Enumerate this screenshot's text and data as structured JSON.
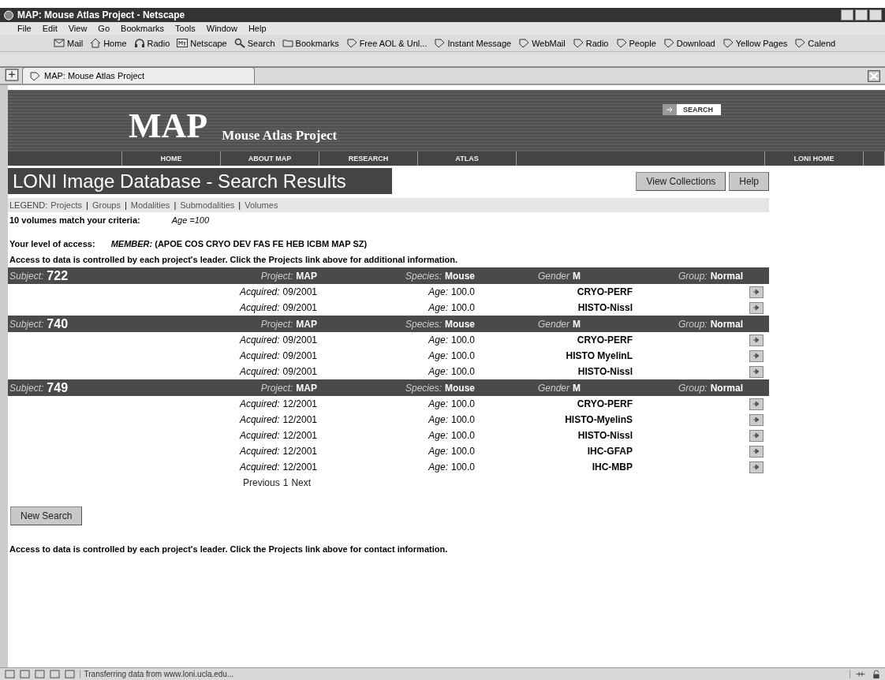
{
  "window": {
    "title": "MAP: Mouse Atlas Project - Netscape"
  },
  "menu": [
    "File",
    "Edit",
    "View",
    "Go",
    "Bookmarks",
    "Tools",
    "Window",
    "Help"
  ],
  "toolbar": [
    {
      "kind": "mail",
      "label": "Mail"
    },
    {
      "kind": "home",
      "label": "Home"
    },
    {
      "kind": "radio",
      "label": "Radio"
    },
    {
      "kind": "my",
      "label": "Netscape"
    },
    {
      "kind": "search",
      "label": "Search"
    },
    {
      "kind": "folder",
      "label": "Bookmarks"
    },
    {
      "kind": "bookmark",
      "label": "Free AOL & Unl..."
    },
    {
      "kind": "bookmark",
      "label": "Instant Message"
    },
    {
      "kind": "bookmark",
      "label": "WebMail"
    },
    {
      "kind": "bookmark",
      "label": "Radio"
    },
    {
      "kind": "bookmark",
      "label": "People"
    },
    {
      "kind": "bookmark",
      "label": "Download"
    },
    {
      "kind": "bookmark",
      "label": "Yellow Pages"
    },
    {
      "kind": "bookmark",
      "label": "Calend"
    }
  ],
  "tabs": [
    {
      "label": "MAP: Mouse Atlas Project",
      "selected": true
    }
  ],
  "site": {
    "logo": "MAP",
    "subtitle": "Mouse Atlas Project",
    "search": "SEARCH",
    "nav": [
      "HOME",
      "ABOUT MAP",
      "RESEARCH",
      "ATLAS",
      "LONI HOME"
    ]
  },
  "page_title": "LONI Image Database - Search Results",
  "buttons": [
    "View Collections",
    "Help"
  ],
  "legend": {
    "label": "LEGEND:",
    "items": [
      {
        "kind": "link",
        "text": "Projects"
      },
      {
        "kind": "separator",
        "text": "|"
      },
      {
        "kind": "link",
        "text": "Groups"
      },
      {
        "kind": "separator",
        "text": "|"
      },
      {
        "kind": "link",
        "text": "Modalities"
      },
      {
        "kind": "separator",
        "text": "|"
      },
      {
        "kind": "link",
        "text": "Submodalities"
      },
      {
        "kind": "separator",
        "text": "|"
      },
      {
        "kind": "link",
        "text": "Volumes"
      }
    ]
  },
  "match": {
    "count": "10 volumes match your criteria:",
    "criteria": "Age =100"
  },
  "access": {
    "label": "Your level of access:",
    "level": "MEMBER:",
    "projects": "(APOE COS CRYO DEV FAS FE HEB ICBM MAP SZ)"
  },
  "notice": "Access to data is controlled by each project's leader. Click the Projects link above for additional information.",
  "subjects": [
    {
      "subject_label": "Subject:",
      "id": "722",
      "project_label": "Project:",
      "project": "MAP",
      "species_label": "Species:",
      "species": "Mouse",
      "gender_label": "Gender",
      "gender": "M",
      "group_label": "Group:",
      "group": "Normal",
      "rows": [
        {
          "acquired_label": "Acquired:",
          "acquired": "09/2001",
          "age_label": "Age:",
          "age": "100.0",
          "volume": "CRYO-PERF"
        },
        {
          "acquired_label": "Acquired:",
          "acquired": "09/2001",
          "age_label": "Age:",
          "age": "100.0",
          "volume": "HISTO-Nissl"
        }
      ]
    },
    {
      "subject_label": "Subject:",
      "id": "740",
      "project_label": "Project:",
      "project": "MAP",
      "species_label": "Species:",
      "species": "Mouse",
      "gender_label": "Gender",
      "gender": "M",
      "group_label": "Group:",
      "group": "Normal",
      "rows": [
        {
          "acquired_label": "Acquired:",
          "acquired": "09/2001",
          "age_label": "Age:",
          "age": "100.0",
          "volume": "CRYO-PERF"
        },
        {
          "acquired_label": "Acquired:",
          "acquired": "09/2001",
          "age_label": "Age:",
          "age": "100.0",
          "volume": "HISTO MyelinL"
        },
        {
          "acquired_label": "Acquired:",
          "acquired": "09/2001",
          "age_label": "Age:",
          "age": "100.0",
          "volume": "HISTO-Nissl"
        }
      ]
    },
    {
      "subject_label": "Subject:",
      "id": "749",
      "project_label": "Project:",
      "project": "MAP",
      "species_label": "Species:",
      "species": "Mouse",
      "gender_label": "Gender",
      "gender": "M",
      "group_label": "Group:",
      "group": "Normal",
      "rows": [
        {
          "acquired_label": "Acquired:",
          "acquired": "12/2001",
          "age_label": "Age:",
          "age": "100.0",
          "volume": "CRYO-PERF"
        },
        {
          "acquired_label": "Acquired:",
          "acquired": "12/2001",
          "age_label": "Age:",
          "age": "100.0",
          "volume": "HISTO-MyelinS"
        },
        {
          "acquired_label": "Acquired:",
          "acquired": "12/2001",
          "age_label": "Age:",
          "age": "100.0",
          "volume": "HISTO-Nissl"
        },
        {
          "acquired_label": "Acquired:",
          "acquired": "12/2001",
          "age_label": "Age:",
          "age": "100.0",
          "volume": "IHC-GFAP"
        },
        {
          "acquired_label": "Acquired:",
          "acquired": "12/2001",
          "age_label": "Age:",
          "age": "100.0",
          "volume": "IHC-MBP"
        }
      ]
    }
  ],
  "pagination": [
    "Previous",
    "1",
    "Next"
  ],
  "new_search": "New Search",
  "footer_note": "Access to data is controlled by each project's leader. Click the Projects link above for contact information.",
  "status_bar": "Transferring data from www.loni.ucla.edu..."
}
